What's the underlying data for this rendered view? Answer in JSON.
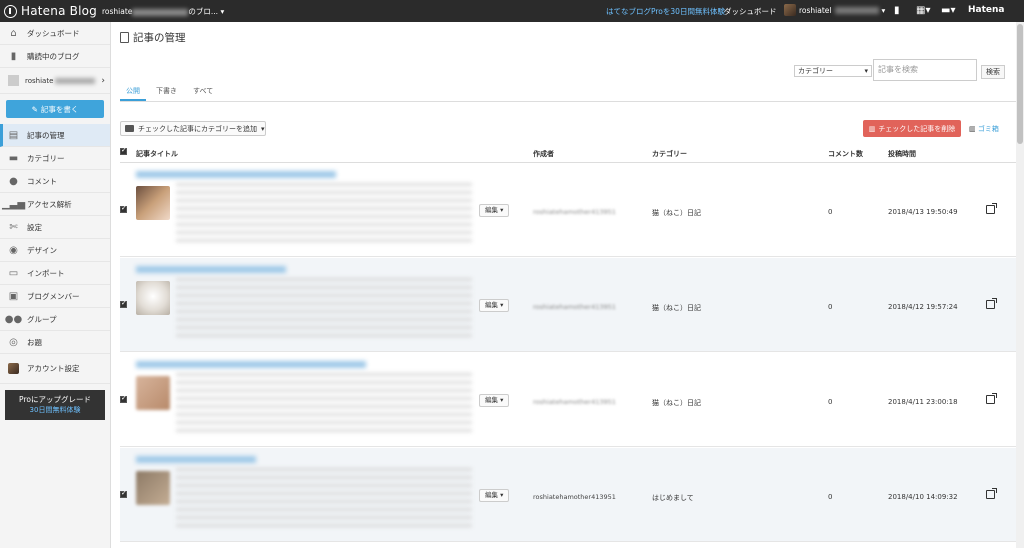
{
  "topbar": {
    "logo": "Hatena Blog",
    "blog_selector_prefix": "roshiate",
    "blog_selector_suffix": "のブロ...",
    "pro_trial": "はてなブログProを30日間無料体験",
    "dashboard": "ダッシュボード",
    "user": "roshiatel",
    "hatena": "Hatena"
  },
  "sidebar": {
    "items": [
      {
        "label": "ダッシュボード",
        "icon": "home-icon"
      },
      {
        "label": "購読中のブログ",
        "icon": "bookmark-icon"
      }
    ],
    "blog_name": "roshiate",
    "write_button": "記事を書く",
    "manage_items": [
      {
        "label": "記事の管理",
        "icon": "document-icon"
      },
      {
        "label": "カテゴリー",
        "icon": "folder-icon"
      },
      {
        "label": "コメント",
        "icon": "comment-icon"
      },
      {
        "label": "アクセス解析",
        "icon": "chart-icon"
      },
      {
        "label": "設定",
        "icon": "wrench-icon"
      },
      {
        "label": "デザイン",
        "icon": "palette-icon"
      },
      {
        "label": "インポート",
        "icon": "truck-icon"
      },
      {
        "label": "ブログメンバー",
        "icon": "members-icon"
      }
    ],
    "group": "グループ",
    "odai": "お題",
    "account": "アカウント設定",
    "upgrade_title": "Proにアップグレード",
    "upgrade_sub": "30日間無料体験"
  },
  "main": {
    "title": "記事の管理",
    "category_select": "カテゴリー",
    "search_placeholder": "記事を検索",
    "search_button": "検索",
    "tabs": [
      "公開",
      "下書き",
      "すべて"
    ],
    "add_category": "チェックした記事にカテゴリーを追加",
    "delete_checked": "チェックした記事を削除",
    "trash": "ゴミ箱",
    "columns": {
      "title": "記事タイトル",
      "author": "作成者",
      "category": "カテゴリー",
      "comments": "コメント数",
      "posted": "投稿時間"
    },
    "rows": [
      {
        "author": "roshiatehamother413951",
        "category": "猫（ねこ）日記",
        "comments": "0",
        "posted": "2018/4/13 19:50:49",
        "edit": "編集",
        "thumb_color": "#8d6e63"
      },
      {
        "author": "roshiatehamother413951",
        "category": "猫（ねこ）日記",
        "comments": "0",
        "posted": "2018/4/12 19:57:24",
        "edit": "編集",
        "thumb_color": "#e8e4de"
      },
      {
        "author": "roshiatehamother413951",
        "category": "猫（ねこ）日記",
        "comments": "0",
        "posted": "2018/4/11 23:00:18",
        "edit": "編集",
        "thumb_color": "#c9a589"
      },
      {
        "author": "roshiatehamother413951",
        "category": "はじめまして",
        "comments": "0",
        "posted": "2018/4/10 14:09:32",
        "edit": "編集",
        "thumb_color": "#a38b74"
      }
    ]
  }
}
